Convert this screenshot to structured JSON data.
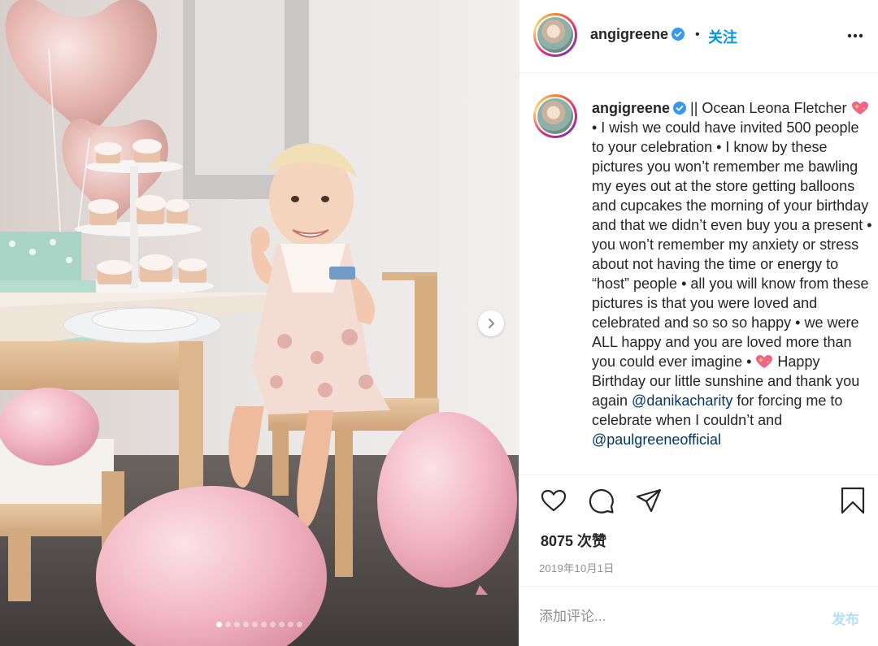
{
  "post": {
    "username": "angigreene",
    "follow_label": "关注",
    "separator": "•",
    "caption": {
      "part1": " || Ocean Leona Fletcher ",
      "part2": " • I wish we could have invited 500 people to your celebration • I know by these pictures you won’t remember me bawling my eyes out at the store getting balloons and cupcakes the morning of your birthday and that we didn’t even buy you a present • you won’t remember my anxiety or stress about not having the time or energy to “host” people • all you will know from these pictures is that you were loved and celebrated and so so so happy • we were ALL happy and you are loved more than you could ever imagine • ",
      "part3": " Happy Birthday our little sunshine and thank you again ",
      "mention1": "@danikacharity",
      "part4": " for forcing me to celebrate when I couldn’t and ",
      "mention2": "@paulgreeneofficial"
    },
    "likes": "8075 次赞",
    "date": "2019年10月1日",
    "comment_placeholder": "添加评论...",
    "post_label": "发布"
  },
  "carousel": {
    "total": 10,
    "active": 0
  },
  "colors": {
    "link_blue": "#0095f6",
    "mention": "#00376b",
    "post_disabled": "#b2dffc",
    "muted": "#8e8e8e",
    "balloon_pink": "#f2b8c3"
  },
  "icons": [
    "verified-icon",
    "more-options-icon",
    "heart-icon",
    "comment-icon",
    "share-icon",
    "bookmark-icon",
    "chevron-right-icon",
    "sparkling-heart-emoji"
  ]
}
